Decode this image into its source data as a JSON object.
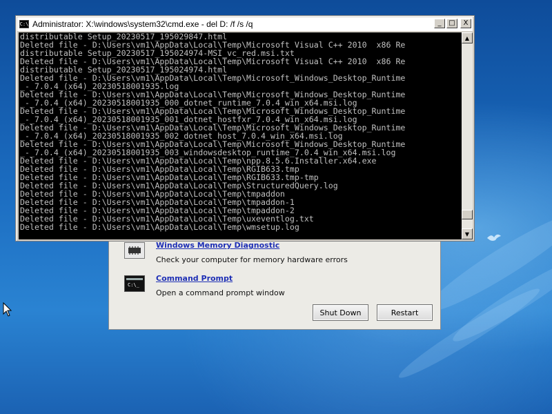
{
  "cmd_window": {
    "title": "Administrator: X:\\windows\\system32\\cmd.exe - del  D: /f /s /q",
    "icon_label": "C:\\",
    "controls": {
      "minimize": "_",
      "maximize": "□",
      "close": "X"
    },
    "lines": [
      "distributable Setup_20230517_195029847.html",
      "Deleted file - D:\\Users\\vm1\\AppData\\Local\\Temp\\Microsoft Visual C++ 2010  x86 Re",
      "distributable Setup_20230517_195024974-MSI_vc_red.msi.txt",
      "Deleted file - D:\\Users\\vm1\\AppData\\Local\\Temp\\Microsoft Visual C++ 2010  x86 Re",
      "distributable Setup_20230517_195024974.html",
      "Deleted file - D:\\Users\\vm1\\AppData\\Local\\Temp\\Microsoft_Windows_Desktop_Runtime",
      "_-_7.0.4_(x64)_20230518001935.log",
      "Deleted file - D:\\Users\\vm1\\AppData\\Local\\Temp\\Microsoft_Windows_Desktop_Runtime",
      "_-_7.0.4_(x64)_20230518001935_000_dotnet_runtime_7.0.4_win_x64.msi.log",
      "Deleted file - D:\\Users\\vm1\\AppData\\Local\\Temp\\Microsoft_Windows_Desktop_Runtime",
      "_-_7.0.4_(x64)_20230518001935_001_dotnet_hostfxr_7.0.4_win_x64.msi.log",
      "Deleted file - D:\\Users\\vm1\\AppData\\Local\\Temp\\Microsoft_Windows_Desktop_Runtime",
      "_-_7.0.4_(x64)_20230518001935_002_dotnet_host_7.0.4_win_x64.msi.log",
      "Deleted file - D:\\Users\\vm1\\AppData\\Local\\Temp\\Microsoft_Windows_Desktop_Runtime",
      "_-_7.0.4_(x64)_20230518001935_003_windowsdesktop_runtime_7.0.4_win_x64.msi.log",
      "Deleted file - D:\\Users\\vm1\\AppData\\Local\\Temp\\npp.8.5.6.Installer.x64.exe",
      "Deleted file - D:\\Users\\vm1\\AppData\\Local\\Temp\\RGIB633.tmp",
      "Deleted file - D:\\Users\\vm1\\AppData\\Local\\Temp\\RGIB633.tmp-tmp",
      "Deleted file - D:\\Users\\vm1\\AppData\\Local\\Temp\\StructuredQuery.log",
      "Deleted file - D:\\Users\\vm1\\AppData\\Local\\Temp\\tmpaddon",
      "Deleted file - D:\\Users\\vm1\\AppData\\Local\\Temp\\tmpaddon-1",
      "Deleted file - D:\\Users\\vm1\\AppData\\Local\\Temp\\tmpaddon-2",
      "Deleted file - D:\\Users\\vm1\\AppData\\Local\\Temp\\uxeventlog.txt",
      "Deleted file - D:\\Users\\vm1\\AppData\\Local\\Temp\\wmsetup.log"
    ],
    "scroll_position": 0.95
  },
  "recovery_dialog": {
    "items": [
      {
        "title": "Windows Memory Diagnostic",
        "description": "Check your computer for memory hardware errors",
        "icon": "memory-chip-icon"
      },
      {
        "title": "Command Prompt",
        "description": "Open a command prompt window",
        "icon": "command-prompt-icon"
      }
    ],
    "shutdown_label": "Shut Down",
    "restart_label": "Restart"
  },
  "colors": {
    "console_bg": "#000000",
    "console_text": "#c0c0c0",
    "link": "#1e2fb5",
    "desktop": "#1b6cc0"
  }
}
